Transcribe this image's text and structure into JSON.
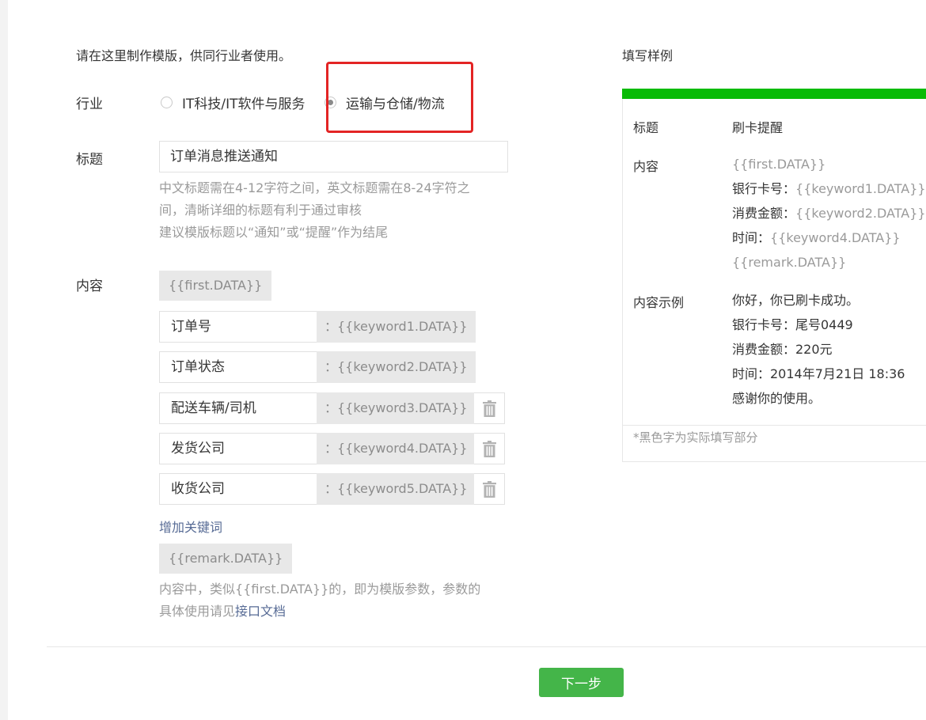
{
  "form": {
    "intro": "请在这里制作模版，供同行业者使用。",
    "industry": {
      "label": "行业",
      "options": [
        {
          "label": "IT科技/IT软件与服务",
          "checked": false
        },
        {
          "label": "运输与仓储/物流",
          "checked": true
        }
      ]
    },
    "title_field": {
      "label": "标题",
      "value": "订单消息推送通知",
      "hint_lines": [
        "中文标题需在4-12字符之间，英文标题需在8-24字符之",
        "间，清晰详细的标题有利于通过审核",
        "建议模版标题以“通知”或“提醒”作为结尾"
      ]
    },
    "content_field": {
      "label": "内容",
      "first_tag": "{{first.DATA}}",
      "keywords": [
        {
          "name": "订单号",
          "value": "：{{keyword1.DATA}}",
          "deletable": false
        },
        {
          "name": "订单状态",
          "value": "：{{keyword2.DATA}}",
          "deletable": false
        },
        {
          "name": "配送车辆/司机",
          "value": "：{{keyword3.DATA}}",
          "deletable": true
        },
        {
          "name": "发货公司",
          "value": "：{{keyword4.DATA}}",
          "deletable": true
        },
        {
          "name": "收货公司",
          "value": "：{{keyword5.DATA}}",
          "deletable": true
        }
      ],
      "add_keyword_label": "增加关键词",
      "remark_tag": "{{remark.DATA}}",
      "hint_line1": "内容中，类似{{first.DATA}}的，即为模版参数，参数的",
      "hint_line2_prefix": "具体使用请见",
      "hint_link": "接口文档"
    },
    "next_button_label": "下一步"
  },
  "sample": {
    "heading": "填写样例",
    "title_label": "标题",
    "title_value": "刷卡提醒",
    "content_label": "内容",
    "content_lines": [
      {
        "prefix": "",
        "value": "{{first.DATA}}"
      },
      {
        "prefix": "银行卡号：",
        "value": "{{keyword1.DATA}}"
      },
      {
        "prefix": "消费金额：",
        "value": "{{keyword2.DATA}}"
      },
      {
        "prefix": "时间：",
        "value": "{{keyword4.DATA}}"
      },
      {
        "prefix": "",
        "value": "{{remark.DATA}}"
      }
    ],
    "example_label": "内容示例",
    "example_lines": [
      "你好，你已刷卡成功。",
      "银行卡号：尾号0449",
      "消费金额：220元",
      "时间：2014年7月21日 18:36",
      "感谢你的使用。"
    ],
    "note": "*黑色字为实际填写部分"
  },
  "colors": {
    "accent_green": "#44b549",
    "bar_green": "#09bb07",
    "highlight_red": "#e32424",
    "link_blue": "#576b95"
  }
}
